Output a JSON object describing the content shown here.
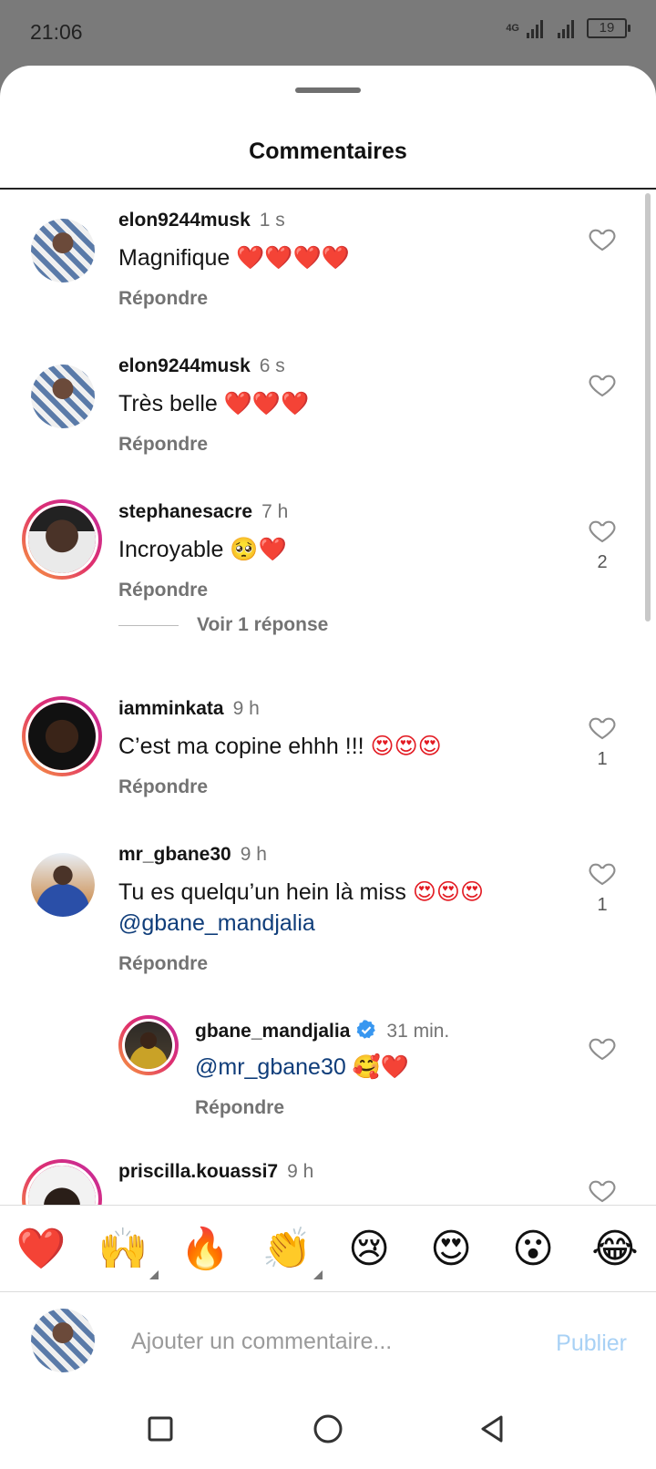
{
  "status": {
    "time": "21:06",
    "network": "4G",
    "battery": "19"
  },
  "sheet": {
    "title": "Commentaires"
  },
  "comments": [
    {
      "user": "elon9244musk",
      "time": "1 s",
      "text": "Magnifique",
      "emoji": "❤️❤️❤️❤️",
      "reply": "Répondre",
      "likes": ""
    },
    {
      "user": "elon9244musk",
      "time": "6 s",
      "text": "Très belle",
      "emoji": "❤️❤️❤️",
      "reply": "Répondre",
      "likes": ""
    },
    {
      "user": "stephanesacre",
      "time": "7 h",
      "text": "Incroyable",
      "emoji": "🥺❤️",
      "reply": "Répondre",
      "likes": "2"
    },
    {
      "user": "iamminkata",
      "time": "9 h",
      "text": "C’est ma copine ehhh !!!",
      "emoji": "😍😍😍",
      "reply": "Répondre",
      "likes": "1"
    },
    {
      "user": "mr_gbane30",
      "time": "9 h",
      "text": "Tu es quelqu’un hein là miss",
      "emoji": "😍😍😍",
      "mention": "@gbane_mandjalia",
      "reply": "Répondre",
      "likes": "1"
    },
    {
      "user": "gbane_mandjalia",
      "time": "31 min.",
      "mention": "@mr_gbane30",
      "emoji": "🥰❤️",
      "reply": "Répondre",
      "likes": "",
      "verified": true
    },
    {
      "user": "priscilla.kouassi7",
      "time": "9 h"
    }
  ],
  "view_replies": "Voir 1 réponse",
  "reactions": [
    "❤️",
    "🙌",
    "🔥",
    "👏",
    "😢",
    "😍",
    "😮",
    "😂"
  ],
  "composer": {
    "placeholder": "Ajouter un commentaire...",
    "post": "Publier"
  },
  "colors": {
    "mention": "#0f3d7a",
    "post_disabled": "#a8d1f5",
    "muted": "#737373"
  }
}
